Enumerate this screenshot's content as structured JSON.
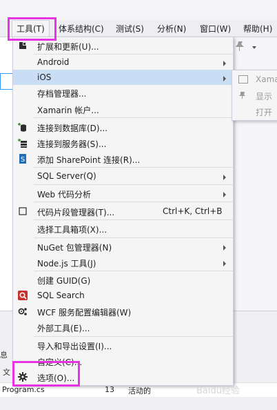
{
  "menubar": {
    "items": [
      {
        "label": "工具(T)"
      },
      {
        "label": "体系结构(C)"
      },
      {
        "label": "测试(S)"
      },
      {
        "label": "分析(N)"
      },
      {
        "label": "窗口(W)"
      },
      {
        "label": "帮助(H)"
      }
    ]
  },
  "dropdown": {
    "items": [
      {
        "label": "扩展和更新(U)...",
        "icon": "extensions-icon"
      },
      {
        "label": "Android",
        "submenu": true
      },
      {
        "label": "iOS",
        "submenu": true,
        "hover": true
      },
      {
        "label": "存档管理器..."
      },
      {
        "label": "Xamarin 帐户..."
      },
      {
        "label": "连接到数据库(D)...",
        "icon": "database-connect-icon"
      },
      {
        "label": "连接到服务器(S)...",
        "icon": "server-connect-icon"
      },
      {
        "label": "添加 SharePoint 连接(R)...",
        "icon": "sharepoint-icon"
      },
      {
        "label": "SQL Server(Q)",
        "submenu": true
      },
      {
        "label": "Web 代码分析",
        "submenu": true
      },
      {
        "label": "代码片段管理器(T)...",
        "shortcut": "Ctrl+K, Ctrl+B",
        "icon": "code-snippet-icon"
      },
      {
        "label": "选择工具箱项(X)..."
      },
      {
        "label": "NuGet 包管理器(N)",
        "submenu": true
      },
      {
        "label": "Node.js 工具(J)",
        "submenu": true
      },
      {
        "label": "创建 GUID(G)"
      },
      {
        "label": "SQL Search",
        "icon": "sql-search-icon"
      },
      {
        "label": "WCF 服务配置编辑器(W)",
        "icon": "wcf-config-icon"
      },
      {
        "label": "外部工具(E)..."
      },
      {
        "label": "导入和导出设置(I)..."
      },
      {
        "label": "自定义(C)..."
      },
      {
        "label": "选项(O)...",
        "icon": "gear-icon"
      }
    ]
  },
  "submenu": {
    "items": [
      {
        "label": "Xama"
      },
      {
        "label": "显示"
      },
      {
        "label": "打开"
      }
    ]
  },
  "bottom": {
    "left_label_1": "息",
    "left_label_2": "文",
    "file": "Program.cs",
    "line": "13",
    "status": "活动的"
  },
  "watermark": "Baidu经验",
  "colors": {
    "highlight_box": "#e434e4",
    "hover": "#c9def5",
    "menu_bg": "#f5f5f5"
  }
}
